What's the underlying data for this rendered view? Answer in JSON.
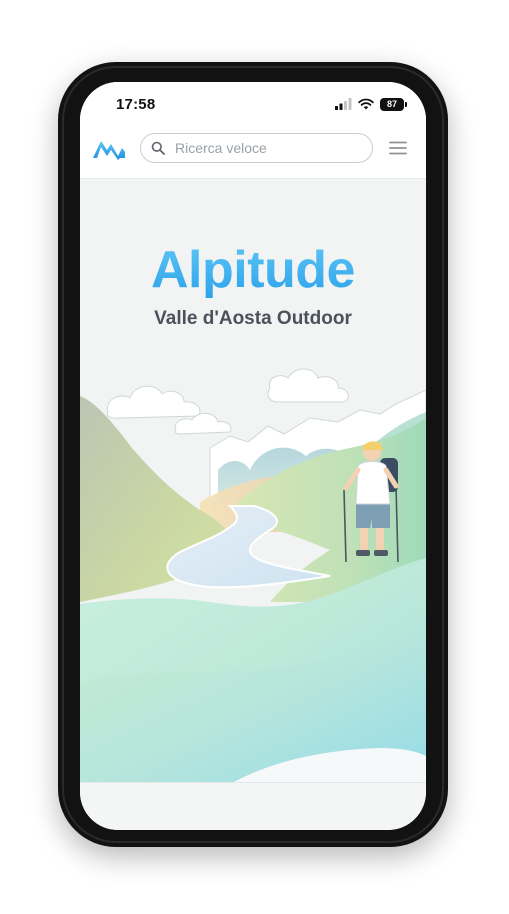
{
  "status_bar": {
    "time": "17:58",
    "battery": "87",
    "icons": [
      "signal-icon",
      "wifi-icon",
      "battery-icon"
    ]
  },
  "header": {
    "logo_icon": "alpitude-logo-icon",
    "search": {
      "placeholder": "Ricerca veloce",
      "value": ""
    },
    "menu_icon": "hamburger-menu-icon"
  },
  "hero": {
    "title": "Alpitude",
    "subtitle": "Valle d'Aosta Outdoor"
  },
  "colors": {
    "accent": "#2aa2ea",
    "subtitle": "#4c525c",
    "background": "#f2f4f4"
  }
}
